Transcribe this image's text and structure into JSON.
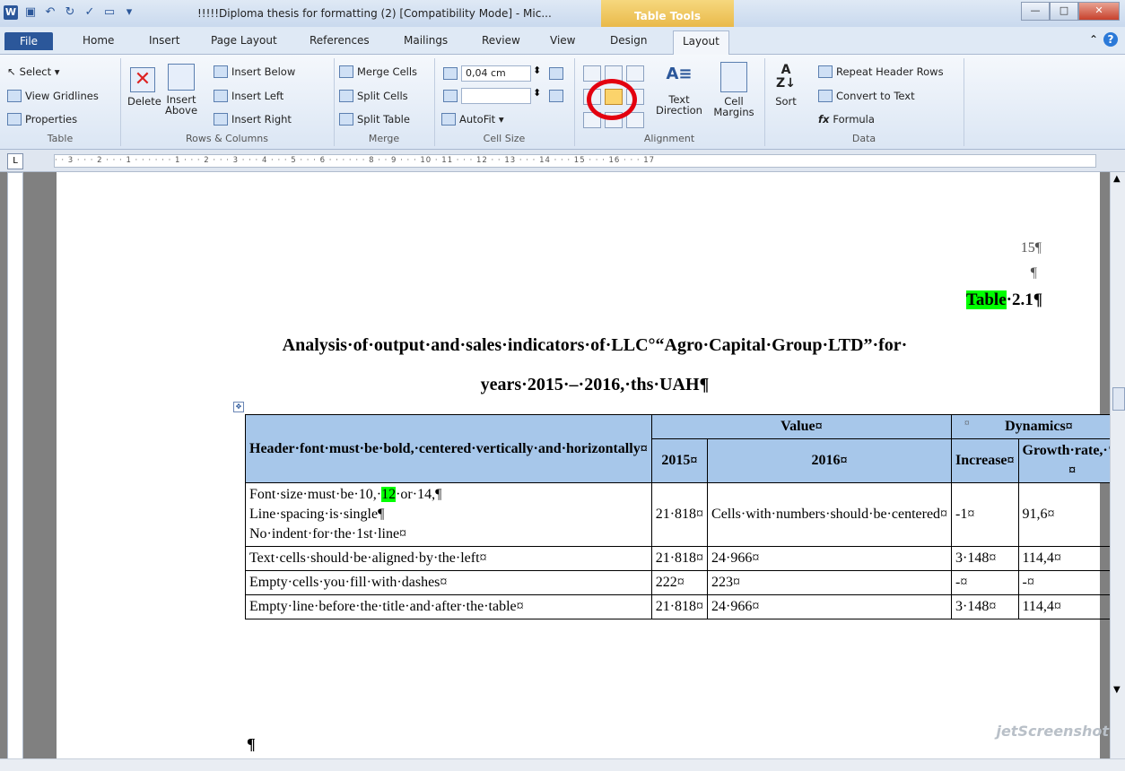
{
  "window": {
    "title": "!!!!!Diploma thesis for formatting (2) [Compatibility Mode] - Mic...",
    "contextual_tab": "Table Tools"
  },
  "tabs": [
    "File",
    "Home",
    "Insert",
    "Page Layout",
    "References",
    "Mailings",
    "Review",
    "View",
    "Design",
    "Layout"
  ],
  "ribbon": {
    "table_group": {
      "label": "Table",
      "select": "Select ▾",
      "gridlines": "View Gridlines",
      "properties": "Properties"
    },
    "rows_cols": {
      "label": "Rows & Columns",
      "delete": "Delete",
      "insert_above_1": "Insert",
      "insert_above_2": "Above",
      "insert_below": "Insert Below",
      "insert_left": "Insert Left",
      "insert_right": "Insert Right"
    },
    "merge": {
      "label": "Merge",
      "merge_cells": "Merge Cells",
      "split_cells": "Split Cells",
      "split_table": "Split Table"
    },
    "cell_size": {
      "label": "Cell Size",
      "height_value": "0,04 cm",
      "width_value": "",
      "autofit": "AutoFit ▾"
    },
    "alignment": {
      "label": "Alignment",
      "text_direction_1": "Text",
      "text_direction_2": "Direction",
      "cell_margins_1": "Cell",
      "cell_margins_2": "Margins"
    },
    "data": {
      "label": "Data",
      "sort": "Sort",
      "repeat_header": "Repeat Header Rows",
      "convert_text": "Convert to Text",
      "formula": "Formula"
    }
  },
  "ruler_text": "· · 3 · · · 2 · · · 1 · · ·     · · · 1 · · · 2 · · · 3 · · · 4 · · · 5 · · · 6 · · ·    · · · 8 · ·      9 · · · 10      · 11 · · · 12      · · 13 · · · 14 · · · 15 · · · 16 · · · 17",
  "document": {
    "page_number": "15¶",
    "empty_para": "¶",
    "table_word": "Table",
    "table_number": "·2.1¶",
    "caption_line1": "Analysis·of·output·and·sales·indicators·of·LLC°“Agro·Capital·Group·LTD”·for·",
    "caption_line2": "years·2015·–·2016,·ths·UAH¶",
    "table": {
      "header_main": "Header·font·must·be·bold,·centered·vertically·and·horizontally¤",
      "value_header": "Value¤",
      "dynamics_header": "Dynamics¤",
      "col_2015": "2015¤",
      "col_2016": "2016¤",
      "col_increase": "Increase¤",
      "col_growth": "Growth·rate,·%¤",
      "row1": {
        "text_a": "Font·size·must·be·10,·",
        "text_hl": "12",
        "text_b": "·or·14,¶",
        "line2": "Line·spacing·is·single¶",
        "line3": "No·indent·for·the·1st·line¤",
        "v2015": "21·818¤",
        "v2016": "Cells·with·numbers·should·be·centered¤",
        "increase": "-1¤",
        "growth": "91,6¤"
      },
      "row2": {
        "text": "Text·cells·should·be·aligned·by·the·left¤",
        "v2015": "21·818¤",
        "v2016": "24·966¤",
        "increase": "3·148¤",
        "growth": "114,4¤"
      },
      "row3": {
        "text": "Empty·cells·you·fill·with·dashes¤",
        "v2015": "222¤",
        "v2016": "223¤",
        "increase": "-¤",
        "growth": "-¤"
      },
      "row4": {
        "text": "Empty·line·before·the·title·and·after·the·table¤",
        "v2015": "21·818¤",
        "v2016": "24·966¤",
        "increase": "3·148¤",
        "growth": "114,4¤"
      },
      "end_mark": "¤"
    },
    "after_table": "¶"
  },
  "watermark": "jetScreenshot"
}
